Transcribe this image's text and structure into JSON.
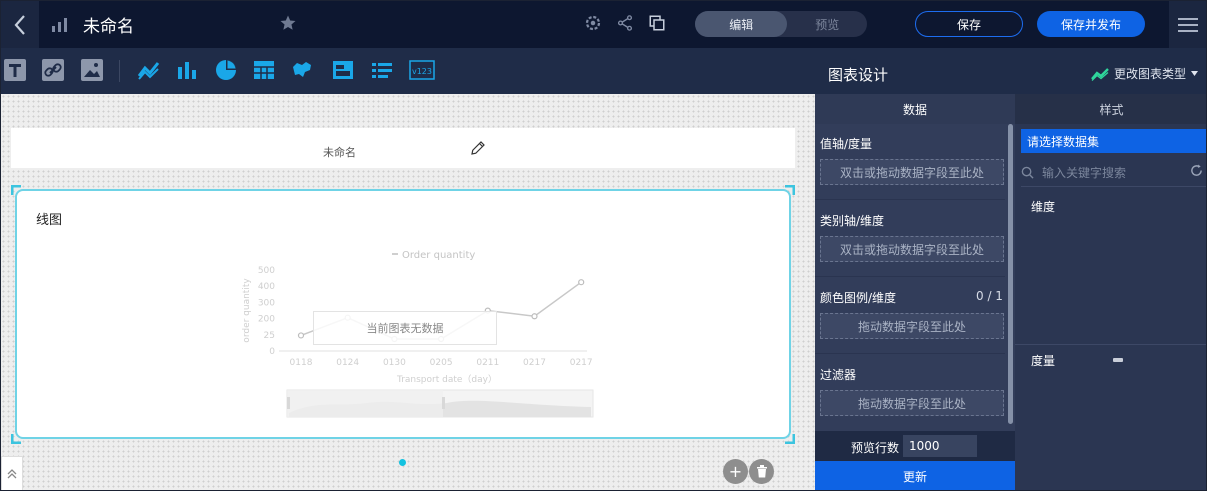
{
  "topbar": {
    "title": "未命名",
    "mode_edit": "编辑",
    "mode_preview": "预览",
    "save_label": "保存",
    "publish_label": "保存并发布"
  },
  "toolbar": {
    "tools": [
      "text-tool",
      "link-tool",
      "image-tool",
      "line-chart-tool",
      "bar-chart-tool",
      "pie-chart-tool",
      "table-tool",
      "map-tool",
      "card-tool",
      "list-tool",
      "kpi-tool"
    ],
    "kpi_label": "v123"
  },
  "canvas": {
    "report_name": "未命名",
    "card_title": "线图",
    "no_data": "当前图表无数据"
  },
  "chart_data": {
    "type": "line",
    "legend": "Order quantity",
    "ylabel": "order quantity",
    "xlabel": "Transport date（day）",
    "y_ticks": [
      "500",
      "400",
      "300",
      "200",
      "25",
      "0"
    ],
    "categories": [
      "0118",
      "0124",
      "0130",
      "0205",
      "0211",
      "0217",
      "0217"
    ],
    "values": [
      25,
      150,
      0,
      0,
      200,
      160,
      400
    ]
  },
  "panel": {
    "title": "图表设计",
    "change_type_label": "更改图表类型",
    "tab_data": "数据",
    "tab_style": "样式",
    "value_axis_label": "值轴/度量",
    "value_axis_drop": "双击或拖动数据字段至此处",
    "category_axis_label": "类别轴/维度",
    "category_axis_drop": "双击或拖动数据字段至此处",
    "color_legend_label": "颜色图例/维度",
    "color_legend_count": "0 / 1",
    "color_legend_drop": "拖动数据字段至此处",
    "filter_label": "过滤器",
    "filter_drop": "拖动数据字段至此处",
    "preview_rows_label": "预览行数",
    "preview_rows_value": "1000",
    "update_label": "更新",
    "dataset_select": "请选择数据集",
    "search_placeholder": "输入关键字搜索",
    "dimension_label": "维度",
    "measure_label": "度量"
  },
  "colors": {
    "accent": "#0e63e4",
    "card_border": "#6fd3e6",
    "topbar_bg": "#0d1730",
    "panel_bg": "#2a3550",
    "chart_icon": "#1aa7e8"
  }
}
